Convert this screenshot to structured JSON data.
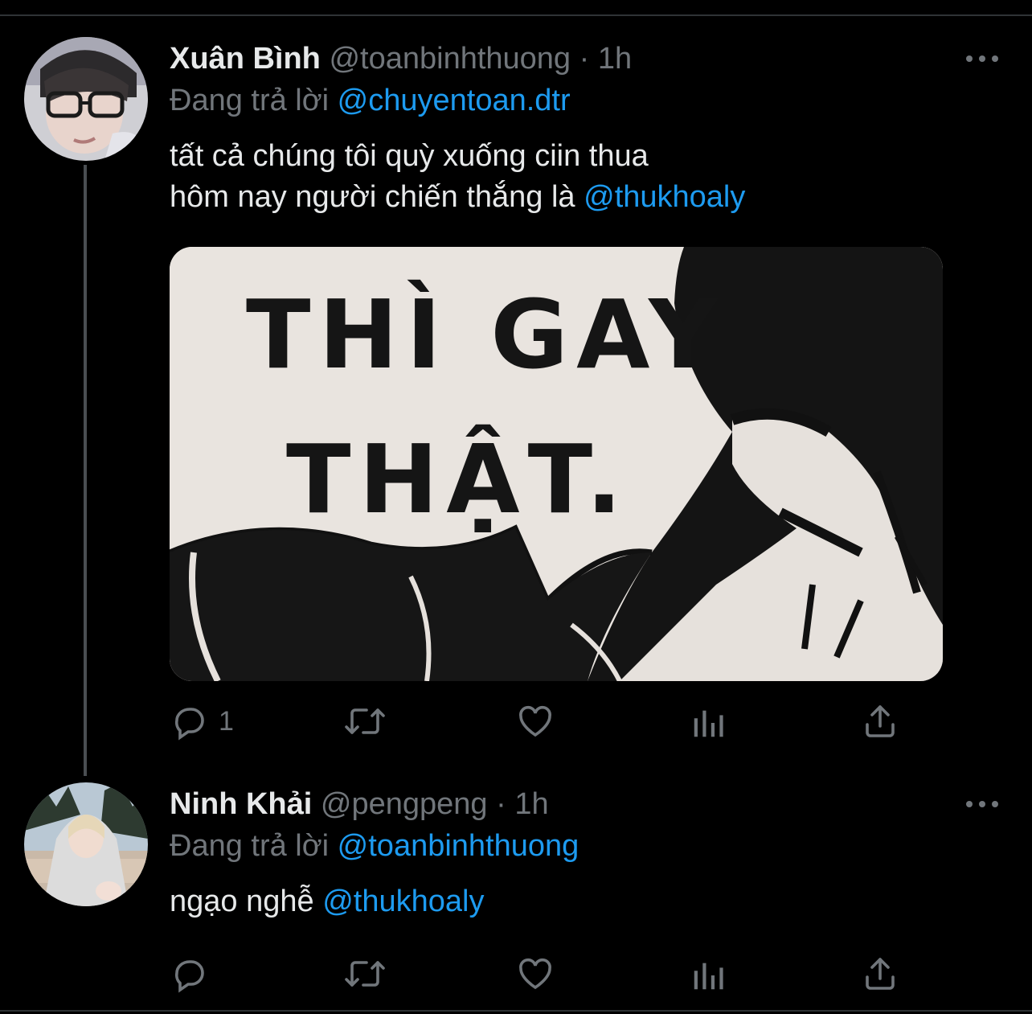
{
  "tweets": [
    {
      "name": "Xuân Bình",
      "handle": "@toanbinhthuong",
      "separator": "·",
      "time": "1h",
      "replying_prefix": "Đang trả lời",
      "replying_to": "@chuyentoan.dtr",
      "text_line1": "tất cả chúng tôi quỳ xuống ciin thua",
      "text_line2_prefix": "hôm nay người chiến thắng là",
      "text_line2_mention": "@thukhoaly",
      "media": {
        "line1": "THÌ GAY",
        "line2": "THẬT."
      },
      "actions": {
        "reply_count": "1"
      }
    },
    {
      "name": "Ninh Khải",
      "handle": "@pengpeng",
      "separator": "·",
      "time": "1h",
      "replying_prefix": "Đang trả lời",
      "replying_to": "@toanbinhthuong",
      "text_prefix": "ngạo nghễ",
      "text_mention": "@thukhoaly",
      "actions": {
        "reply_count": ""
      }
    }
  ],
  "icons": [
    "reply-icon",
    "retweet-icon",
    "like-icon",
    "analytics-icon",
    "share-icon",
    "more-icon"
  ],
  "colors": {
    "background": "#000000",
    "text": "#e7e9ea",
    "secondary": "#71767b",
    "link": "#1d9bf0"
  }
}
